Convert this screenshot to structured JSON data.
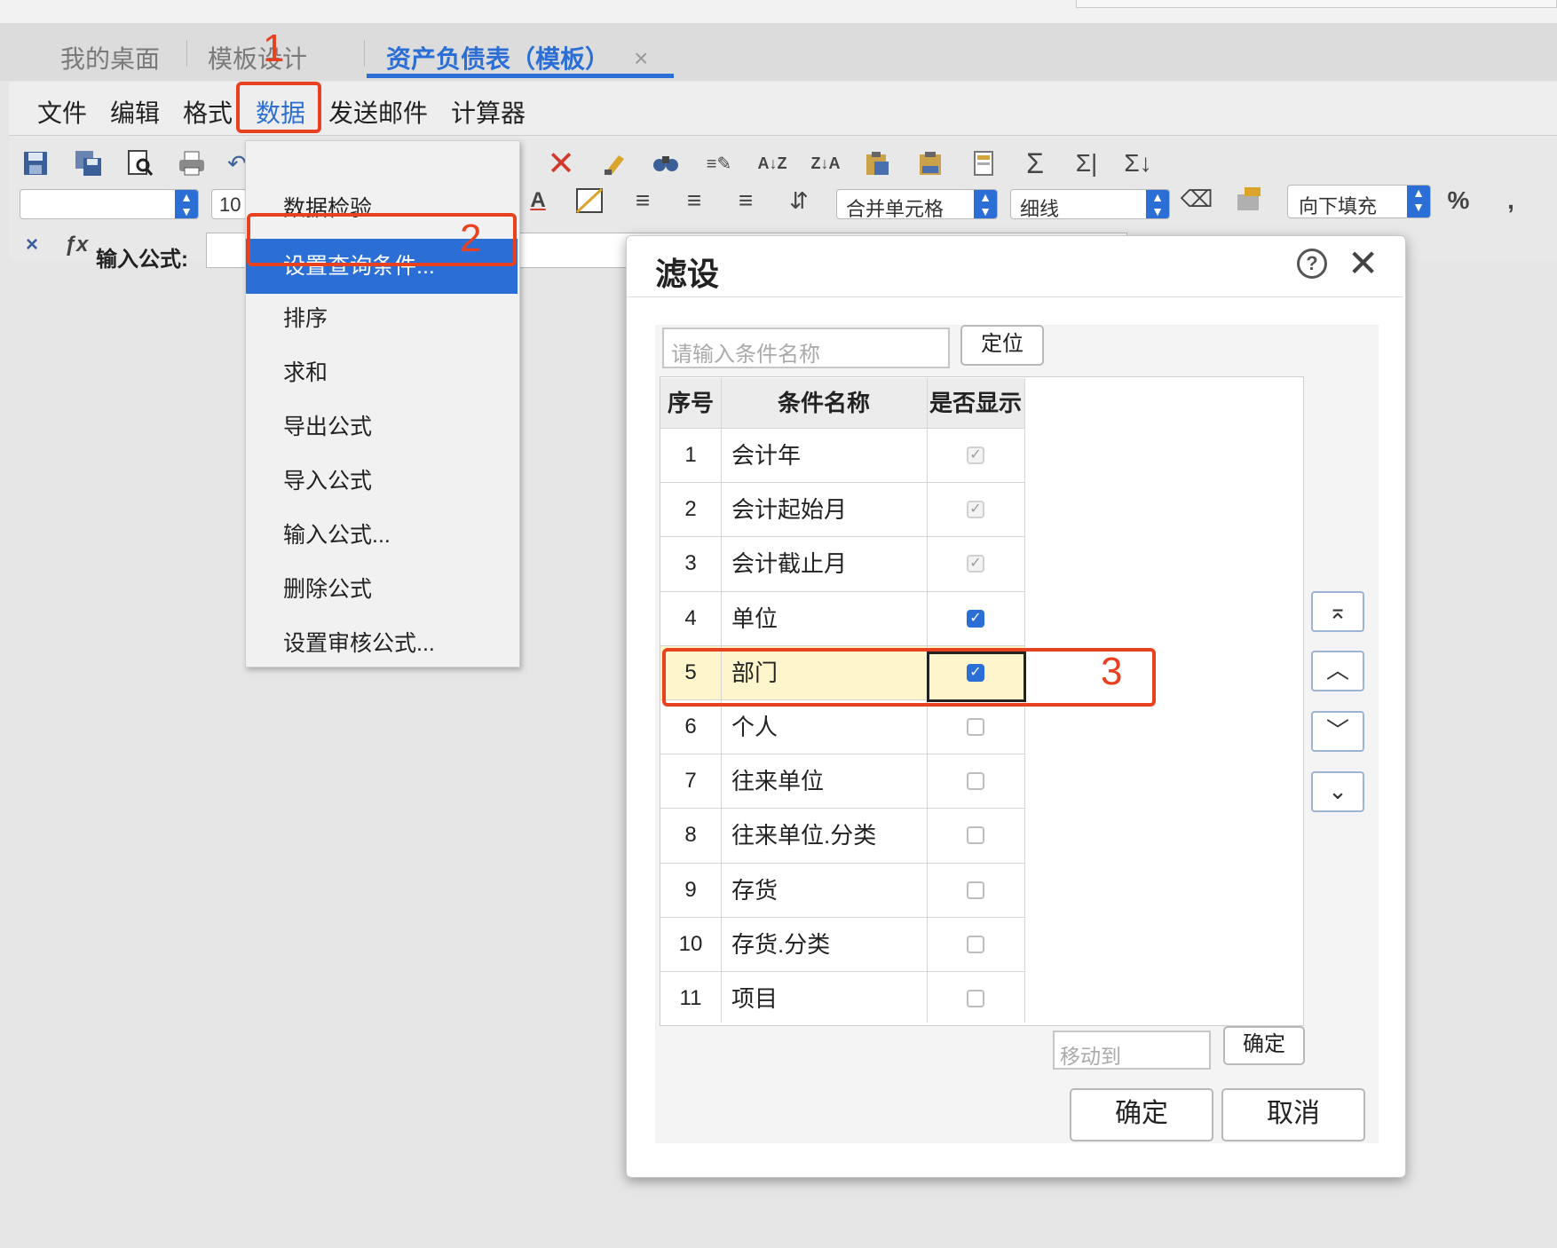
{
  "tabs": [
    {
      "label": "我的桌面",
      "active": false
    },
    {
      "label": "模板设计",
      "active": false
    },
    {
      "label": "资产负债表（模板）",
      "active": true
    }
  ],
  "menubar": [
    "文件",
    "编辑",
    "格式",
    "数据",
    "发送邮件",
    "计算器"
  ],
  "toolbar": {
    "font_size_value": "10",
    "merge_select": "合并单元格",
    "line_select": "细线",
    "fill_select": "向下填充",
    "formula_label": "输入公式:",
    "percent": "%",
    "comma": ","
  },
  "dropdown": {
    "items": [
      "数据检验...",
      "设置查询条件...",
      "排序",
      "求和",
      "导出公式",
      "导入公式",
      "输入公式...",
      "删除公式",
      "设置审核公式..."
    ],
    "highlighted_index": 1
  },
  "annotations": [
    "1",
    "2",
    "3"
  ],
  "dialog": {
    "title": "滤设",
    "search_placeholder": "请输入条件名称",
    "locate_button": "定位",
    "columns": [
      "序号",
      "条件名称",
      "是否显示"
    ],
    "rows": [
      {
        "no": "1",
        "name": "会计年",
        "state": "disabled-checked"
      },
      {
        "no": "2",
        "name": "会计起始月",
        "state": "disabled-checked"
      },
      {
        "no": "3",
        "name": "会计截止月",
        "state": "disabled-checked"
      },
      {
        "no": "4",
        "name": "单位",
        "state": "checked"
      },
      {
        "no": "5",
        "name": "部门",
        "state": "checked"
      },
      {
        "no": "6",
        "name": "个人",
        "state": "unchecked"
      },
      {
        "no": "7",
        "name": "往来单位",
        "state": "unchecked"
      },
      {
        "no": "8",
        "name": "往来单位.分类",
        "state": "unchecked"
      },
      {
        "no": "9",
        "name": "存货",
        "state": "unchecked"
      },
      {
        "no": "10",
        "name": "存货.分类",
        "state": "unchecked"
      },
      {
        "no": "11",
        "name": "项目",
        "state": "unchecked"
      }
    ],
    "selected_row_index": 4,
    "move_to_placeholder": "移动到",
    "move_confirm": "确定",
    "ok": "确定",
    "cancel": "取消"
  },
  "colors": {
    "accent": "#2b6fd6",
    "annotation": "#e8411f",
    "selected_row": "#fff5cc"
  }
}
